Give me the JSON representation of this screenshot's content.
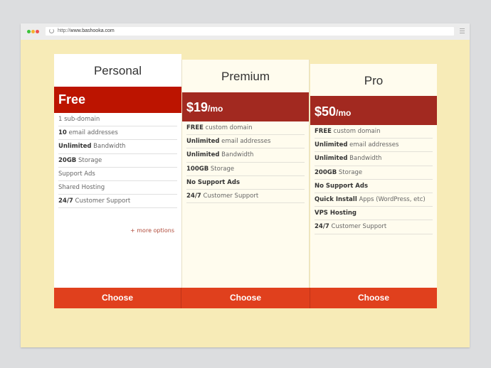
{
  "browser": {
    "url_prefix": "http://",
    "url_host": "www.bashooka.com",
    "traffic_lights": [
      "close",
      "minimize",
      "maximize"
    ]
  },
  "plans": [
    {
      "name": "Personal",
      "price": "Free",
      "price_unit": "",
      "features": [
        {
          "strong": "",
          "text": "1 sub-domain"
        },
        {
          "strong": "10",
          "text": " email addresses"
        },
        {
          "strong": "Unlimited",
          "text": " Bandwidth"
        },
        {
          "strong": "20GB",
          "text": " Storage"
        },
        {
          "strong": "",
          "text": "Support Ads"
        },
        {
          "strong": "",
          "text": "Shared Hosting"
        },
        {
          "strong": "24/7",
          "text": " Customer Support"
        }
      ],
      "more_link": "+ more options",
      "cta": "Choose"
    },
    {
      "name": "Premium",
      "price": "$19",
      "price_unit": "/mo",
      "features": [
        {
          "strong": "FREE",
          "text": " custom domain"
        },
        {
          "strong": "Unlimited",
          "text": " email addresses"
        },
        {
          "strong": "Unlimited",
          "text": " Bandwidth"
        },
        {
          "strong": "100GB",
          "text": " Storage"
        },
        {
          "strong": "No Support Ads",
          "text": ""
        },
        {
          "strong": "24/7",
          "text": " Customer Support"
        }
      ],
      "cta": "Choose"
    },
    {
      "name": "Pro",
      "price": "$50",
      "price_unit": "/mo",
      "features": [
        {
          "strong": "FREE",
          "text": " custom domain"
        },
        {
          "strong": "Unlimited",
          "text": " email addresses"
        },
        {
          "strong": "Unlimited",
          "text": " Bandwidth"
        },
        {
          "strong": "200GB",
          "text": " Storage"
        },
        {
          "strong": "No Support Ads",
          "text": ""
        },
        {
          "strong": "Quick Install",
          "text": " Apps (WordPress, etc)"
        },
        {
          "strong": "VPS Hosting",
          "text": ""
        },
        {
          "strong": "24/7",
          "text": " Customer Support"
        }
      ],
      "cta": "Choose"
    }
  ],
  "colors": {
    "page_bg": "#f7ebb7",
    "free_header": "#bc1400",
    "paid_header": "#a22920",
    "cta": "#e0401d"
  }
}
